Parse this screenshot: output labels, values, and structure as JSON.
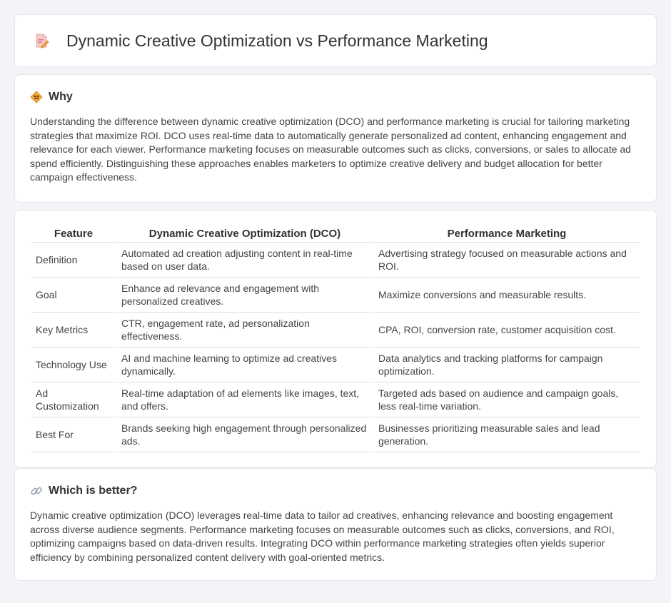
{
  "header": {
    "title": "Dynamic Creative Optimization vs Performance Marketing",
    "icon": "document-edit-icon"
  },
  "why": {
    "title": "Why",
    "icon": "diamond-sign-icon",
    "text": "Understanding the difference between dynamic creative optimization (DCO) and performance marketing is crucial for tailoring marketing strategies that maximize ROI. DCO uses real-time data to automatically generate personalized ad content, enhancing engagement and relevance for each viewer. Performance marketing focuses on measurable outcomes such as clicks, conversions, or sales to allocate ad spend efficiently. Distinguishing these approaches enables marketers to optimize creative delivery and budget allocation for better campaign effectiveness."
  },
  "table": {
    "headers": [
      "Feature",
      "Dynamic Creative Optimization (DCO)",
      "Performance Marketing"
    ],
    "rows": [
      [
        "Definition",
        "Automated ad creation adjusting content in real-time based on user data.",
        "Advertising strategy focused on measurable actions and ROI."
      ],
      [
        "Goal",
        "Enhance ad relevance and engagement with personalized creatives.",
        "Maximize conversions and measurable results."
      ],
      [
        "Key Metrics",
        "CTR, engagement rate, ad personalization effectiveness.",
        "CPA, ROI, conversion rate, customer acquisition cost."
      ],
      [
        "Technology Use",
        "AI and machine learning to optimize ad creatives dynamically.",
        "Data analytics and tracking platforms for campaign optimization."
      ],
      [
        "Ad Customization",
        "Real-time adaptation of ad elements like images, text, and offers.",
        "Targeted ads based on audience and campaign goals, less real-time variation."
      ],
      [
        "Best For",
        "Brands seeking high engagement through personalized ads.",
        "Businesses prioritizing measurable sales and lead generation."
      ]
    ]
  },
  "which": {
    "title": "Which is better?",
    "icon": "link-icon",
    "text": "Dynamic creative optimization (DCO) leverages real-time data to tailor ad creatives, enhancing relevance and boosting engagement across diverse audience segments. Performance marketing focuses on measurable outcomes such as clicks, conversions, and ROI, optimizing campaigns based on data-driven results. Integrating DCO within performance marketing strategies often yields superior efficiency by combining personalized content delivery with goal-oriented metrics."
  }
}
